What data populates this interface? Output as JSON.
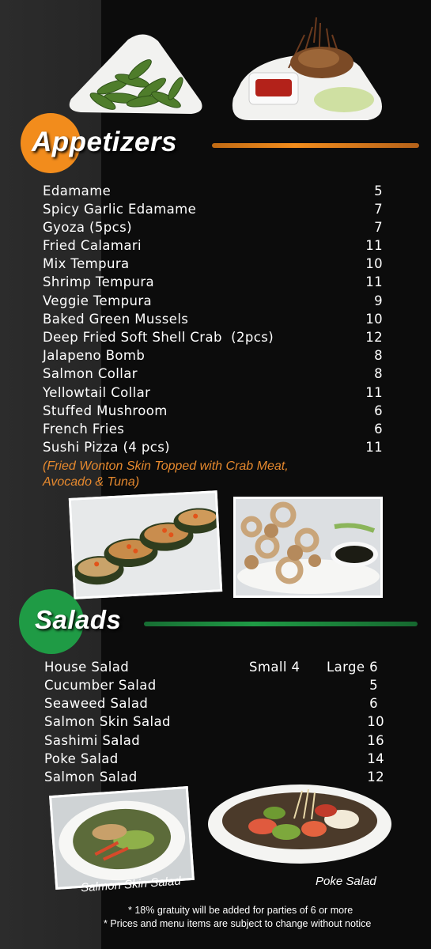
{
  "colors": {
    "appetizers_accent": "#f28c1c",
    "salads_accent": "#1f9b45",
    "description_text": "#e6892e"
  },
  "images": {
    "edamame_photo": "edamame-dish",
    "soft_shell_crab_photo": "soft-shell-crab-dish",
    "mussels_photo": "baked-green-mussels-dish",
    "calamari_photo": "fried-calamari-dish",
    "salmon_skin_salad_photo": "salmon-skin-salad-dish",
    "poke_salad_photo": "poke-salad-dish"
  },
  "appetizers": {
    "title": "Appetizers",
    "items": [
      {
        "name": "Edamame",
        "price": "5"
      },
      {
        "name": "Spicy Garlic Edamame",
        "price": "7"
      },
      {
        "name": "Gyoza (5pcs)",
        "price": "7"
      },
      {
        "name": "Fried Calamari",
        "price": "11"
      },
      {
        "name": "Mix Tempura",
        "price": "10"
      },
      {
        "name": "Shrimp Tempura",
        "price": "11"
      },
      {
        "name": "Veggie Tempura",
        "price": "9"
      },
      {
        "name": "Baked Green Mussels",
        "price": "10"
      },
      {
        "name": "Deep Fried Soft Shell Crab  (2pcs)",
        "price": "12"
      },
      {
        "name": "Jalapeno Bomb",
        "price": "8"
      },
      {
        "name": "Salmon Collar",
        "price": "8"
      },
      {
        "name": "Yellowtail Collar",
        "price": "11"
      },
      {
        "name": "Stuffed Mushroom",
        "price": "6"
      },
      {
        "name": "French Fries",
        "price": "6"
      },
      {
        "name": "Sushi Pizza (4 pcs)",
        "price": "11"
      }
    ],
    "description_line1": "(Fried Wonton Skin Topped with Crab Meat,",
    "description_line2": "Avocado & Tuna)"
  },
  "salads": {
    "title": "Salads",
    "items": [
      {
        "name": "House Salad",
        "small": "Small 4",
        "price": "Large 6"
      },
      {
        "name": "Cucumber Salad",
        "price": "5"
      },
      {
        "name": "Seaweed Salad",
        "price": "6"
      },
      {
        "name": "Salmon Skin Salad",
        "price": "10"
      },
      {
        "name": "Sashimi Salad",
        "price": "16"
      },
      {
        "name": "Poke Salad",
        "price": "14"
      },
      {
        "name": "Salmon Salad",
        "price": "12"
      }
    ],
    "caption_left": "Salmon Skin Salad",
    "caption_right": "Poke Salad"
  },
  "notes": {
    "gratuity": "* 18% gratuity will be added for parties of 6 or more",
    "prices": "*  Prices and menu items are subject to change without notice"
  }
}
